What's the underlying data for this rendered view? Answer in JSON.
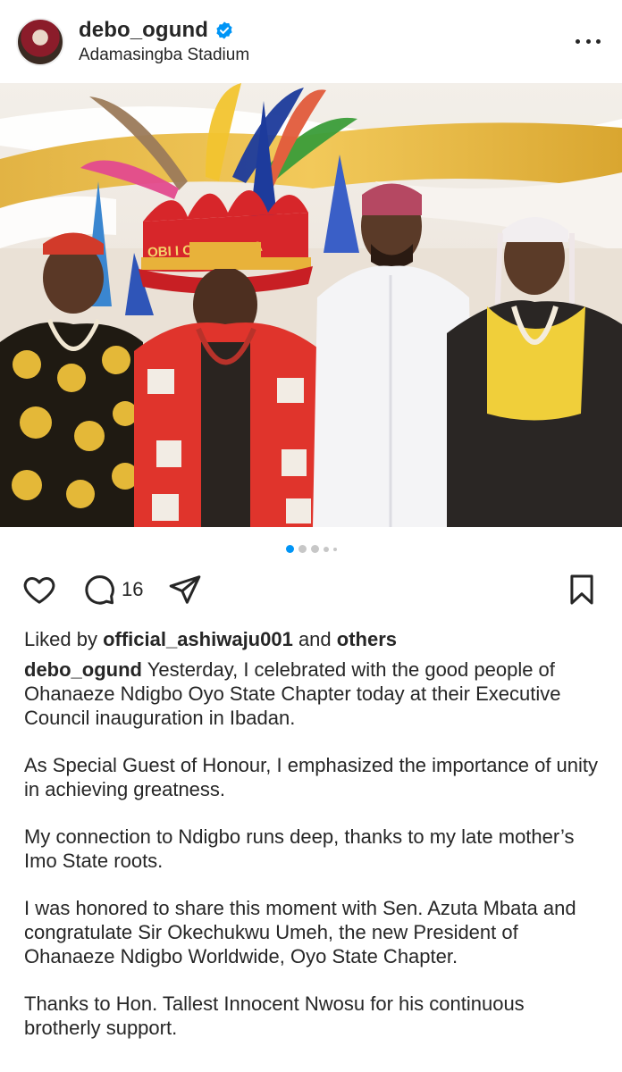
{
  "post": {
    "username": "debo_ogund",
    "location": "Adamasingba Stadium",
    "verified": true,
    "verified_color": "#0095f6",
    "icons": {
      "avatar": "profile-photo",
      "verified": "verified-badge-icon",
      "more": "more-options-icon"
    }
  },
  "photo": {
    "description_icon": "post-photo",
    "crown_text": "OBI I OF YORUBA"
  },
  "carousel": {
    "count": 5,
    "active_index": 0
  },
  "actions": {
    "like_icon": "heart-icon",
    "comment_icon": "comment-icon",
    "comment_count": "16",
    "share_icon": "share-icon",
    "save_icon": "bookmark-icon"
  },
  "likes": {
    "prefix": "Liked by ",
    "user": "official_ashiwaju001",
    "middle": " and ",
    "others": "others"
  },
  "caption": {
    "username": "debo_ogund",
    "p1": " Yesterday, I celebrated with the good people of Ohanaeze Ndigbo Oyo State Chapter today at their Executive Council inauguration in Ibadan.",
    "p2": "As Special Guest of Honour, I emphasized the importance of unity in achieving greatness.",
    "p3": "My connection to Ndigbo runs deep, thanks to my late mother’s Imo State roots.",
    "p4": "I was honored to share this moment with Sen. Azuta Mbata and congratulate Sir Okechukwu Umeh, the new President of Ohanaeze Ndigbo Worldwide, Oyo State Chapter.",
    "p5": "Thanks to Hon. Tallest Innocent Nwosu for his continuous brotherly support."
  }
}
